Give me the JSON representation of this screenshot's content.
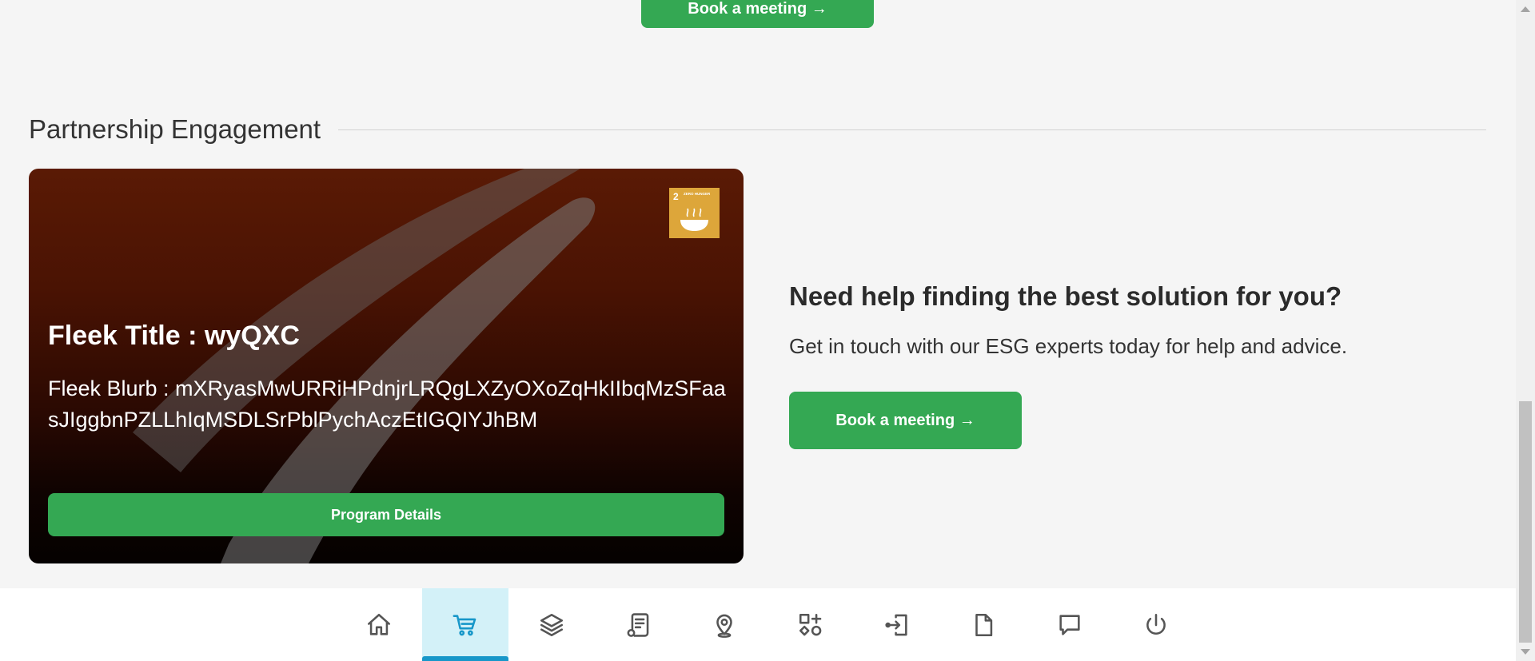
{
  "top_button": {
    "label": "Book a meeting →"
  },
  "section": {
    "title": "Partnership Engagement"
  },
  "card": {
    "title": "Fleek Title : wyQXC",
    "blurb": "Fleek Blurb : mXRyasMwURRiHPdnjrLRQgLXZyOXoZqHkIIbqMzSFaasJIggbnPZLLhIqMSDLSrPblPychAczEtIGQIYJhBM",
    "badge": {
      "number": "2",
      "text": "ZERO HUNGER",
      "color": "#dda63a"
    },
    "button_label": "Program Details"
  },
  "help": {
    "title": "Need help finding the best solution for you?",
    "subtitle": "Get in touch with our ESG experts today for help and advice.",
    "button_label": "Book a meeting →"
  },
  "nav": {
    "items": [
      {
        "icon": "home-icon",
        "active": false
      },
      {
        "icon": "cart-icon",
        "active": true
      },
      {
        "icon": "layers-icon",
        "active": false
      },
      {
        "icon": "receipt-icon",
        "active": false
      },
      {
        "icon": "location-pin-icon",
        "active": false
      },
      {
        "icon": "shapes-grid-icon",
        "active": false
      },
      {
        "icon": "login-icon",
        "active": false
      },
      {
        "icon": "document-icon",
        "active": false
      },
      {
        "icon": "chat-icon",
        "active": false
      },
      {
        "icon": "power-icon",
        "active": false
      }
    ],
    "active_color": "#1797c9",
    "active_background": "#d3f1f8"
  },
  "colors": {
    "primary": "#34a853",
    "page_background": "#f5f5f5"
  }
}
